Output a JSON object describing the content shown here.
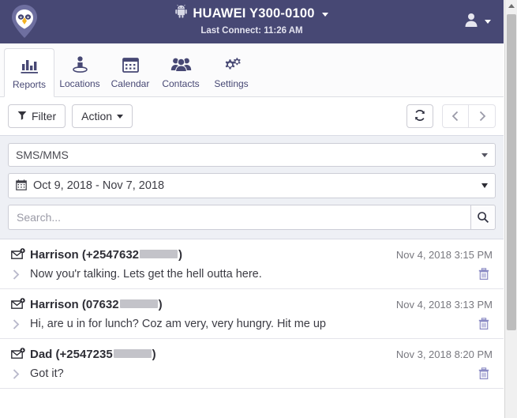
{
  "header": {
    "logo_icon": "owl-pin-logo",
    "device_icon": "android-icon",
    "device_name": "HUAWEI Y300-0100",
    "last_connect": "Last Connect: 11:26 AM",
    "user_icon": "user-avatar-icon",
    "bg_color": "#474874"
  },
  "tabs": [
    {
      "label": "Reports",
      "icon": "bar-chart-icon",
      "active": true
    },
    {
      "label": "Locations",
      "icon": "person-pin-icon",
      "active": false
    },
    {
      "label": "Calendar",
      "icon": "calendar-icon",
      "active": false
    },
    {
      "label": "Contacts",
      "icon": "people-icon",
      "active": false
    },
    {
      "label": "Settings",
      "icon": "gears-icon",
      "active": false
    }
  ],
  "toolbar": {
    "filter_label": "Filter",
    "filter_icon": "funnel-icon",
    "action_label": "Action",
    "refresh_icon": "refresh-icon",
    "prev_icon": "chevron-left-icon",
    "next_icon": "chevron-right-icon"
  },
  "filters": {
    "report_type": "SMS/MMS",
    "date_range": "Oct 9, 2018 - Nov 7, 2018",
    "date_icon": "calendar-icon",
    "search_value": "",
    "search_placeholder": "Search...",
    "search_icon": "search-icon"
  },
  "messages": [
    {
      "icon": "incoming-message-icon",
      "sender_prefix": "Harrison (+2547632",
      "sender_suffix": ")",
      "date": "Nov 4, 2018 3:15 PM",
      "text": "Now you'r talking. Lets get the hell outta here.",
      "expand_icon": "chevron-right-icon",
      "delete_icon": "trash-icon"
    },
    {
      "icon": "incoming-message-icon",
      "sender_prefix": "Harrison (07632",
      "sender_suffix": ")",
      "date": "Nov 4, 2018 3:13 PM",
      "text": "Hi, are u in for lunch? Coz am very, very hungry. Hit me up",
      "expand_icon": "chevron-right-icon",
      "delete_icon": "trash-icon"
    },
    {
      "icon": "incoming-message-icon",
      "sender_prefix": "Dad (+2547235",
      "sender_suffix": ")",
      "date": "Nov 3, 2018 8:20 PM",
      "text": "Got it?",
      "expand_icon": "chevron-right-icon",
      "delete_icon": "trash-icon"
    }
  ],
  "scrollbar": {
    "name": "vertical-scrollbar"
  }
}
